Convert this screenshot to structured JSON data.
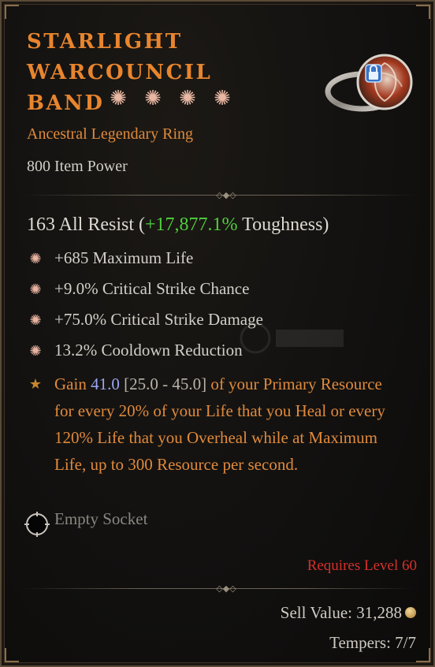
{
  "item": {
    "name_line1": "STARLIGHT",
    "name_line2": "WARCOUNCIL",
    "name_line3": "BAND",
    "greater_affix_stars": 4,
    "type": "Ancestral Legendary Ring",
    "item_power": "800 Item Power",
    "image_icon": "ring-icon",
    "lock_icon": "lock-icon"
  },
  "implicit": {
    "prefix": "163 All Resist (",
    "toughness_value": "+17,877.1%",
    "suffix": " Toughness)"
  },
  "affixes": [
    {
      "text": "+685 Maximum Life",
      "icon": "greater-affix-icon"
    },
    {
      "text": "+9.0% Critical Strike Chance",
      "icon": "greater-affix-icon"
    },
    {
      "text": "+75.0% Critical Strike Damage",
      "icon": "greater-affix-icon"
    },
    {
      "text": "13.2% Cooldown Reduction",
      "icon": "greater-affix-icon"
    }
  ],
  "legendary_power": {
    "icon": "legendary-star-icon",
    "lead": "Gain ",
    "value": "41.0",
    "range": " [25.0 - 45.0]",
    "text": " of your Primary Resource for every 20% of your Life that you Heal or every 120% Life that you Overheal while at Maximum Life, up to 300 Resource per second."
  },
  "socket": {
    "label": "Empty Socket",
    "icon": "empty-socket-icon"
  },
  "requirement": "Requires Level 60",
  "sell_value": "Sell Value: 31,288",
  "tempers": "Tempers: 7/7",
  "colors": {
    "title": "#e8852e",
    "legendary_text": "#e08a3c",
    "toughness": "#4fcf3c",
    "rolled_value": "#9aa6f5",
    "requirement": "#d4302a"
  }
}
